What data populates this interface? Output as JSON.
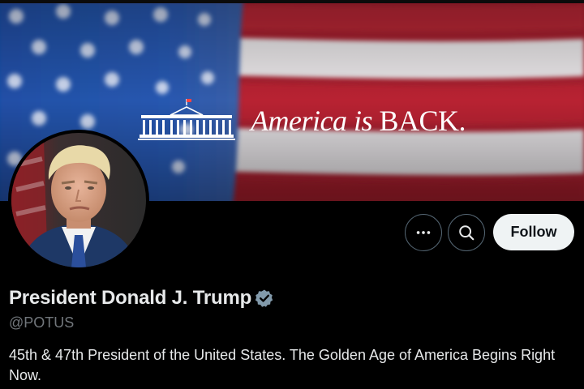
{
  "banner": {
    "caption_italic": "America is",
    "caption_bold": "BACK.",
    "emblem_icon": "white-house-icon"
  },
  "avatar": {
    "icon": "profile-photo"
  },
  "actions": {
    "more_icon": "more-icon",
    "search_icon": "search-icon",
    "follow_label": "Follow"
  },
  "profile": {
    "display_name": "President Donald J. Trump",
    "verified_icon": "verified-badge-icon",
    "handle": "@POTUS",
    "bio": "45th & 47th President of the United States. The Golden Age of America Begins Right Now."
  },
  "colors": {
    "background": "#000000",
    "text_primary": "#e7e9ea",
    "text_secondary": "#71767b",
    "button_border": "#536471",
    "follow_bg": "#eff3f4"
  }
}
